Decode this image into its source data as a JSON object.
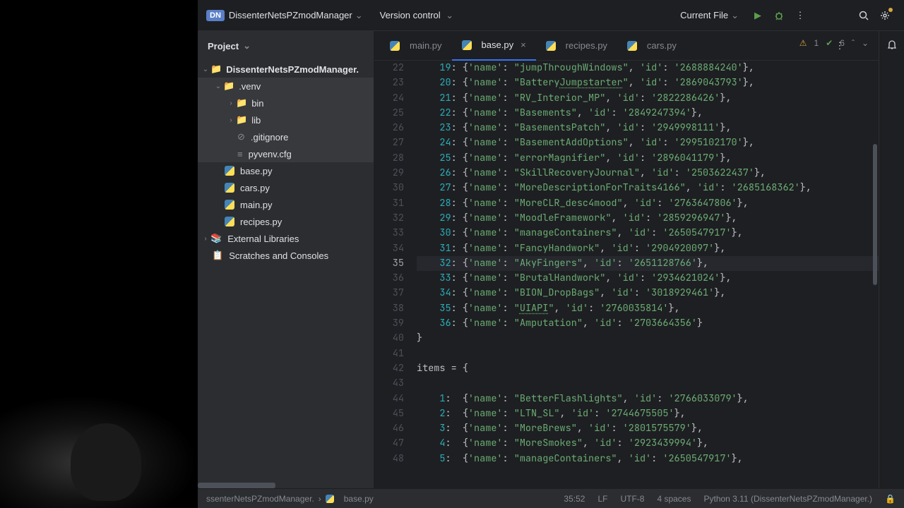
{
  "topbar": {
    "project_badge": "DN",
    "project_name": "DissenterNetsPZmodManager",
    "version_control": "Version control",
    "current_file": "Current File"
  },
  "sidebar": {
    "header": "Project",
    "root": "DissenterNetsPZmodManager.",
    "venv": ".venv",
    "bin": "bin",
    "lib": "lib",
    "gitignore": ".gitignore",
    "pyvenv": "pyvenv.cfg",
    "base": "base.py",
    "cars": "cars.py",
    "main": "main.py",
    "recipes": "recipes.py",
    "ext_lib": "External Libraries",
    "scratches": "Scratches and Consoles"
  },
  "tabs": {
    "main": "main.py",
    "base": "base.py",
    "recipes": "recipes.py",
    "cars": "cars.py"
  },
  "inspection": {
    "warn_count": "1",
    "check_count": "6"
  },
  "gutter_start": 22,
  "code_lines": [
    {
      "n": 22,
      "key": 19,
      "name": "jumpThroughWindows",
      "id": "2688884240",
      "end": ","
    },
    {
      "n": 23,
      "key": 20,
      "name": "BatteryJumpstarter",
      "id": "2869043793",
      "end": ",",
      "underline_part": "Jumpstarter"
    },
    {
      "n": 24,
      "key": 21,
      "name": "RV_Interior_MP",
      "id": "2822286426",
      "end": ","
    },
    {
      "n": 25,
      "key": 22,
      "name": "Basements",
      "id": "2849247394",
      "end": ","
    },
    {
      "n": 26,
      "key": 23,
      "name": "BasementsPatch",
      "id": "2949998111",
      "end": ","
    },
    {
      "n": 27,
      "key": 24,
      "name": "BasementAddOptions",
      "id": "2995102170",
      "end": ","
    },
    {
      "n": 28,
      "key": 25,
      "name": "errorMagnifier",
      "id": "2896041179",
      "end": ","
    },
    {
      "n": 29,
      "key": 26,
      "name": "SkillRecoveryJournal",
      "id": "2503622437",
      "end": ","
    },
    {
      "n": 30,
      "key": 27,
      "name": "MoreDescriptionForTraits4166",
      "id": "2685168362",
      "end": ","
    },
    {
      "n": 31,
      "key": 28,
      "name": "MoreCLR_desc4mood",
      "id": "2763647806",
      "end": ","
    },
    {
      "n": 32,
      "key": 29,
      "name": "MoodleFramework",
      "id": "2859296947",
      "end": ","
    },
    {
      "n": 33,
      "key": 30,
      "name": "manageContainers",
      "id": "2650547917",
      "end": ","
    },
    {
      "n": 34,
      "key": 31,
      "name": "FancyHandwork",
      "id": "2904920097",
      "end": ","
    },
    {
      "n": 35,
      "key": 32,
      "name": "AkyFingers",
      "id": "2651128766",
      "end": ",",
      "current": true
    },
    {
      "n": 36,
      "key": 33,
      "name": "BrutalHandwork",
      "id": "2934621024",
      "end": ","
    },
    {
      "n": 37,
      "key": 34,
      "name": "BION_DropBags",
      "id": "3018929461",
      "end": ","
    },
    {
      "n": 38,
      "key": 35,
      "name": "UIAPI",
      "id": "2760035814",
      "end": ",",
      "underline_full": true
    },
    {
      "n": 39,
      "key": 36,
      "name": "Amputation",
      "id": "2703664356",
      "end": ""
    }
  ],
  "close_brace_line": 40,
  "blank_line": 41,
  "items_decl_line": 42,
  "items_decl": "items = {",
  "blank_line2": 43,
  "items_lines": [
    {
      "n": 44,
      "key": 1,
      "name": "BetterFlashlights",
      "id": "2766033079",
      "end": ","
    },
    {
      "n": 45,
      "key": 2,
      "name": "LTN_SL",
      "id": "2744675505",
      "end": ","
    },
    {
      "n": 46,
      "key": 3,
      "name": "MoreBrews",
      "id": "2801575579",
      "end": ","
    },
    {
      "n": 47,
      "key": 4,
      "name": "MoreSmokes",
      "id": "2923439994",
      "end": ","
    },
    {
      "n": 48,
      "key": 5,
      "name": "manageContainers",
      "id": "2650547917",
      "end": ","
    }
  ],
  "breadcrumb": {
    "root": "ssenterNetsPZmodManager.",
    "file": "base.py"
  },
  "statusbar": {
    "pos": "35:52",
    "eol": "LF",
    "enc": "UTF-8",
    "indent": "4 spaces",
    "interp": "Python 3.11 (DissenterNetsPZmodManager.)"
  }
}
